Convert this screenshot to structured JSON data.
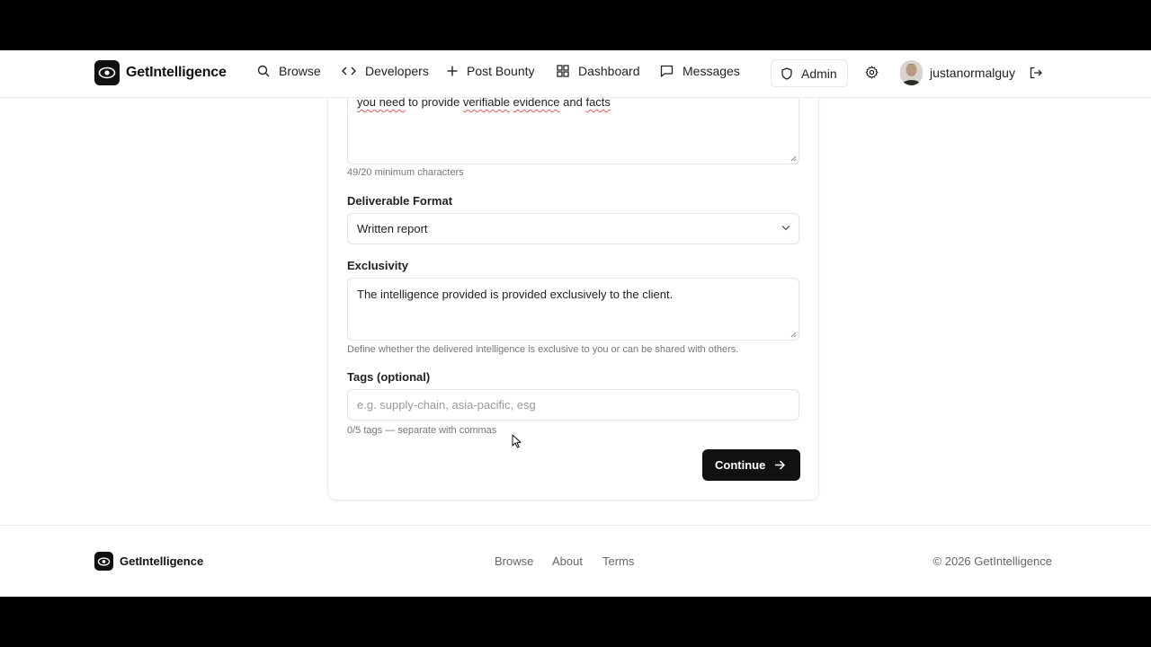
{
  "header": {
    "brand": "GetIntelligence",
    "nav": {
      "browse": "Browse",
      "developers": "Developers",
      "post_bounty": "Post Bounty",
      "dashboard": "Dashboard",
      "messages": "Messages"
    },
    "admin": "Admin",
    "username": "justanormalguy"
  },
  "form": {
    "description_value_start": "you need",
    "description_value_mid": " to provide ",
    "description_value_word": "verifiable",
    "description_value_word2": "evidence",
    "description_value_and": " and ",
    "description_value_end": "facts",
    "description_hint": "49/20 minimum characters",
    "deliverable_label": "Deliverable Format",
    "deliverable_value": "Written report",
    "exclusivity_label": "Exclusivity",
    "exclusivity_value": "The intelligence provided is provided exclusively to the client.",
    "exclusivity_hint": "Define whether the delivered intelligence is exclusive to you or can be shared with others.",
    "tags_label": "Tags (optional)",
    "tags_placeholder": "e.g. supply-chain, asia-pacific, esg",
    "tags_hint": "0/5 tags — separate with commas",
    "continue_label": "Continue"
  },
  "footer": {
    "brand": "GetIntelligence",
    "links": {
      "browse": "Browse",
      "about": "About",
      "terms": "Terms"
    },
    "copyright": "© 2026 GetIntelligence"
  },
  "colors": {
    "primary": "#111111",
    "border": "#e4e4e4",
    "muted": "#777777",
    "spellcheck": "#e05a5a"
  }
}
